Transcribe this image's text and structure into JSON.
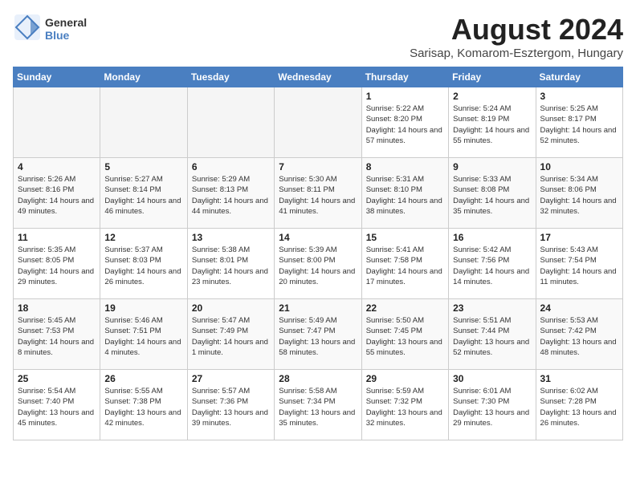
{
  "logo": {
    "text_general": "General",
    "text_blue": "Blue"
  },
  "title": {
    "month_year": "August 2024",
    "location": "Sarisap, Komarom-Esztergom, Hungary"
  },
  "weekdays": [
    "Sunday",
    "Monday",
    "Tuesday",
    "Wednesday",
    "Thursday",
    "Friday",
    "Saturday"
  ],
  "weeks": [
    [
      {
        "day": "",
        "empty": true
      },
      {
        "day": "",
        "empty": true
      },
      {
        "day": "",
        "empty": true
      },
      {
        "day": "",
        "empty": true
      },
      {
        "day": "1",
        "sunrise": "5:22 AM",
        "sunset": "8:20 PM",
        "daylight": "14 hours and 57 minutes."
      },
      {
        "day": "2",
        "sunrise": "5:24 AM",
        "sunset": "8:19 PM",
        "daylight": "14 hours and 55 minutes."
      },
      {
        "day": "3",
        "sunrise": "5:25 AM",
        "sunset": "8:17 PM",
        "daylight": "14 hours and 52 minutes."
      }
    ],
    [
      {
        "day": "4",
        "sunrise": "5:26 AM",
        "sunset": "8:16 PM",
        "daylight": "14 hours and 49 minutes."
      },
      {
        "day": "5",
        "sunrise": "5:27 AM",
        "sunset": "8:14 PM",
        "daylight": "14 hours and 46 minutes."
      },
      {
        "day": "6",
        "sunrise": "5:29 AM",
        "sunset": "8:13 PM",
        "daylight": "14 hours and 44 minutes."
      },
      {
        "day": "7",
        "sunrise": "5:30 AM",
        "sunset": "8:11 PM",
        "daylight": "14 hours and 41 minutes."
      },
      {
        "day": "8",
        "sunrise": "5:31 AM",
        "sunset": "8:10 PM",
        "daylight": "14 hours and 38 minutes."
      },
      {
        "day": "9",
        "sunrise": "5:33 AM",
        "sunset": "8:08 PM",
        "daylight": "14 hours and 35 minutes."
      },
      {
        "day": "10",
        "sunrise": "5:34 AM",
        "sunset": "8:06 PM",
        "daylight": "14 hours and 32 minutes."
      }
    ],
    [
      {
        "day": "11",
        "sunrise": "5:35 AM",
        "sunset": "8:05 PM",
        "daylight": "14 hours and 29 minutes."
      },
      {
        "day": "12",
        "sunrise": "5:37 AM",
        "sunset": "8:03 PM",
        "daylight": "14 hours and 26 minutes."
      },
      {
        "day": "13",
        "sunrise": "5:38 AM",
        "sunset": "8:01 PM",
        "daylight": "14 hours and 23 minutes."
      },
      {
        "day": "14",
        "sunrise": "5:39 AM",
        "sunset": "8:00 PM",
        "daylight": "14 hours and 20 minutes."
      },
      {
        "day": "15",
        "sunrise": "5:41 AM",
        "sunset": "7:58 PM",
        "daylight": "14 hours and 17 minutes."
      },
      {
        "day": "16",
        "sunrise": "5:42 AM",
        "sunset": "7:56 PM",
        "daylight": "14 hours and 14 minutes."
      },
      {
        "day": "17",
        "sunrise": "5:43 AM",
        "sunset": "7:54 PM",
        "daylight": "14 hours and 11 minutes."
      }
    ],
    [
      {
        "day": "18",
        "sunrise": "5:45 AM",
        "sunset": "7:53 PM",
        "daylight": "14 hours and 8 minutes."
      },
      {
        "day": "19",
        "sunrise": "5:46 AM",
        "sunset": "7:51 PM",
        "daylight": "14 hours and 4 minutes."
      },
      {
        "day": "20",
        "sunrise": "5:47 AM",
        "sunset": "7:49 PM",
        "daylight": "14 hours and 1 minute."
      },
      {
        "day": "21",
        "sunrise": "5:49 AM",
        "sunset": "7:47 PM",
        "daylight": "13 hours and 58 minutes."
      },
      {
        "day": "22",
        "sunrise": "5:50 AM",
        "sunset": "7:45 PM",
        "daylight": "13 hours and 55 minutes."
      },
      {
        "day": "23",
        "sunrise": "5:51 AM",
        "sunset": "7:44 PM",
        "daylight": "13 hours and 52 minutes."
      },
      {
        "day": "24",
        "sunrise": "5:53 AM",
        "sunset": "7:42 PM",
        "daylight": "13 hours and 48 minutes."
      }
    ],
    [
      {
        "day": "25",
        "sunrise": "5:54 AM",
        "sunset": "7:40 PM",
        "daylight": "13 hours and 45 minutes."
      },
      {
        "day": "26",
        "sunrise": "5:55 AM",
        "sunset": "7:38 PM",
        "daylight": "13 hours and 42 minutes."
      },
      {
        "day": "27",
        "sunrise": "5:57 AM",
        "sunset": "7:36 PM",
        "daylight": "13 hours and 39 minutes."
      },
      {
        "day": "28",
        "sunrise": "5:58 AM",
        "sunset": "7:34 PM",
        "daylight": "13 hours and 35 minutes."
      },
      {
        "day": "29",
        "sunrise": "5:59 AM",
        "sunset": "7:32 PM",
        "daylight": "13 hours and 32 minutes."
      },
      {
        "day": "30",
        "sunrise": "6:01 AM",
        "sunset": "7:30 PM",
        "daylight": "13 hours and 29 minutes."
      },
      {
        "day": "31",
        "sunrise": "6:02 AM",
        "sunset": "7:28 PM",
        "daylight": "13 hours and 26 minutes."
      }
    ]
  ]
}
